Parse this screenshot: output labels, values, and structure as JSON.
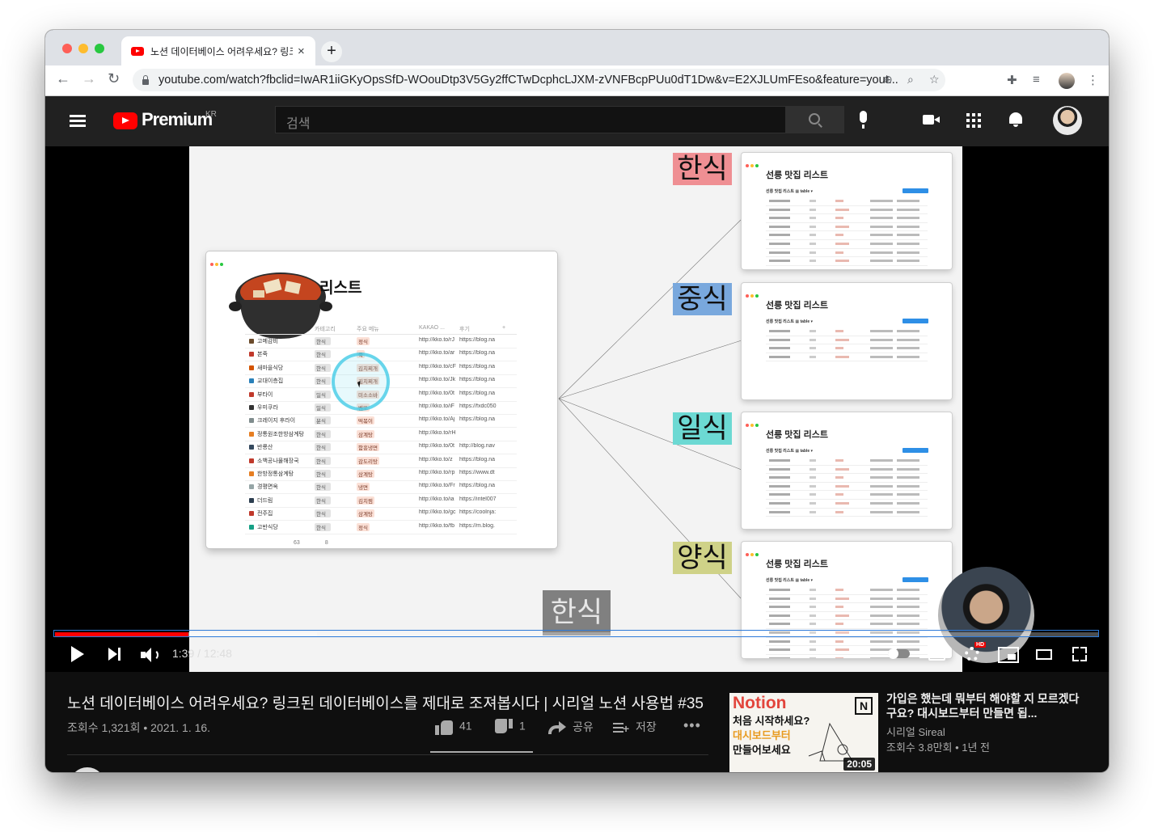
{
  "browser": {
    "tab_title": "노션 데이터베이스 어려우세요? 링크",
    "tab_close": "×",
    "new_tab": "+",
    "url": "youtube.com/watch?fbclid=IwAR1iiGKyOpsSfD-WOouDtp3V5Gy2ffCTwDcphcLJXM-zVNFBcpPUu0dT1Dw&v=E2XJLUmFEso&feature=yout...",
    "back": "←",
    "forward": "→",
    "reload": "↻",
    "omni_icons": [
      "⊕",
      "⌕",
      "☆"
    ],
    "toolbar_icons": [
      "✚",
      "≡",
      "⋮"
    ]
  },
  "youtube": {
    "logo_text": "Premium",
    "country": "KR",
    "search_placeholder": "검색"
  },
  "slide": {
    "main_card": {
      "title": "리스트",
      "headers": [
        "카테고리",
        "주요 메뉴",
        "KAKAO ...",
        "후기",
        "+"
      ],
      "rows": [
        {
          "name": "고메감비",
          "cat": "한식",
          "menu": "정식",
          "kakao": "http://kko.to/rJ",
          "review": "https://blog.na",
          "color": "#6b4b2b"
        },
        {
          "name": "본죽",
          "cat": "한식",
          "menu": "죽",
          "kakao": "http://kko.to/ar",
          "review": "https://blog.na",
          "color": "#c0392b"
        },
        {
          "name": "새마을식당",
          "cat": "한식",
          "menu": "김치찌개",
          "kakao": "http://kko.to/cF",
          "review": "https://blog.na",
          "color": "#d35400"
        },
        {
          "name": "교대이층집",
          "cat": "한식",
          "menu": "김치찌개",
          "kakao": "http://kko.to/Jk",
          "review": "https://blog.na",
          "color": "#2980b9"
        },
        {
          "name": "부타이",
          "cat": "일식",
          "menu": "미소소바",
          "kakao": "http://kko.to/0t",
          "review": "https://blog.na",
          "color": "#c0392b"
        },
        {
          "name": "우미쿠라",
          "cat": "일식",
          "menu": "벤또",
          "kakao": "http://kko.to/iF",
          "review": "https://fxdc050:",
          "color": "#333333"
        },
        {
          "name": "크레이지 후라이",
          "cat": "분식",
          "menu": "떡볶이",
          "kakao": "http://kko.to/Aj",
          "review": "https://blog.na",
          "color": "#7f8c8d"
        },
        {
          "name": "정통원조한방삼계탕",
          "cat": "한식",
          "menu": "삼계탕",
          "kakao": "http://kko.to/rH",
          "review": "",
          "color": "#e67e22"
        },
        {
          "name": "반룡산",
          "cat": "한식",
          "menu": "함흥냉면",
          "kakao": "http://kko.to/0t",
          "review": "http://blog.nav",
          "color": "#34495e"
        },
        {
          "name": "소백공나물해장국",
          "cat": "한식",
          "menu": "감도리탕",
          "kakao": "http://kko.to/z",
          "review": "https://blog.na",
          "color": "#c0392b"
        },
        {
          "name": "한방정통삼계탕",
          "cat": "한식",
          "menu": "삼계탕",
          "kakao": "http://kko.to/rp",
          "review": "https://www.dt",
          "color": "#e67e22"
        },
        {
          "name": "경평면옥",
          "cat": "한식",
          "menu": "냉면",
          "kakao": "http://kko.to/Fr",
          "review": "https://blog.na",
          "color": "#95a5a6"
        },
        {
          "name": "더드림",
          "cat": "한식",
          "menu": "김치찜",
          "kakao": "http://kko.to/ia",
          "review": "https://intel007",
          "color": "#2c3e50"
        },
        {
          "name": "전주집",
          "cat": "한식",
          "menu": "삼계탕",
          "kakao": "http://kko.to/gc",
          "review": "https://coolnja:",
          "color": "#c0392b"
        },
        {
          "name": "고반식당",
          "cat": "한식",
          "menu": "정식",
          "kakao": "http://kko.to/fb",
          "review": "https://m.blog.",
          "color": "#16a085"
        }
      ],
      "footer_count": "63",
      "footer_count2": "8"
    },
    "labels": [
      "한식",
      "중식",
      "일식",
      "양식"
    ],
    "mini_title": "선릉 맛집 리스트",
    "mini_sub": "선릉 맛집 리스트 ▦ table ▾",
    "subtitle": "한식"
  },
  "player": {
    "time": "1:39 / 12:48",
    "progress_fraction": 0.128,
    "buffer_fraction": 0.251,
    "hd_badge": "HD"
  },
  "video": {
    "title": "노션 데이터베이스 어려우세요? 링크된 데이터베이스를 제대로 조져봅시다 | 시리얼 노션 사용법 #35",
    "meta": "조회수 1,321회 • 2021. 1. 16.",
    "like_count": "41",
    "dislike_count": "1",
    "share_label": "공유",
    "save_label": "저장",
    "more": "•••"
  },
  "recommended": {
    "brand": "Notion",
    "n_logo": "N",
    "thumb_line1": "처음 시작하세요?",
    "thumb_line2": "대시보드부터",
    "thumb_line3": "만들어보세요",
    "duration": "20:05",
    "title": "가입은 했는데 뭐부터 해야할 지 모르겠다구요? 대시보드부터 만들면 됩...",
    "channel": "시리얼 Sireal",
    "meta": "조회수 3.8만회 • 1년 전"
  },
  "colors": {
    "accent_red": "#ff0000",
    "label_korean": "#ef8f93",
    "label_chinese": "#79a8dd",
    "label_japanese": "#6cd9d3",
    "label_western": "#cfd288"
  }
}
